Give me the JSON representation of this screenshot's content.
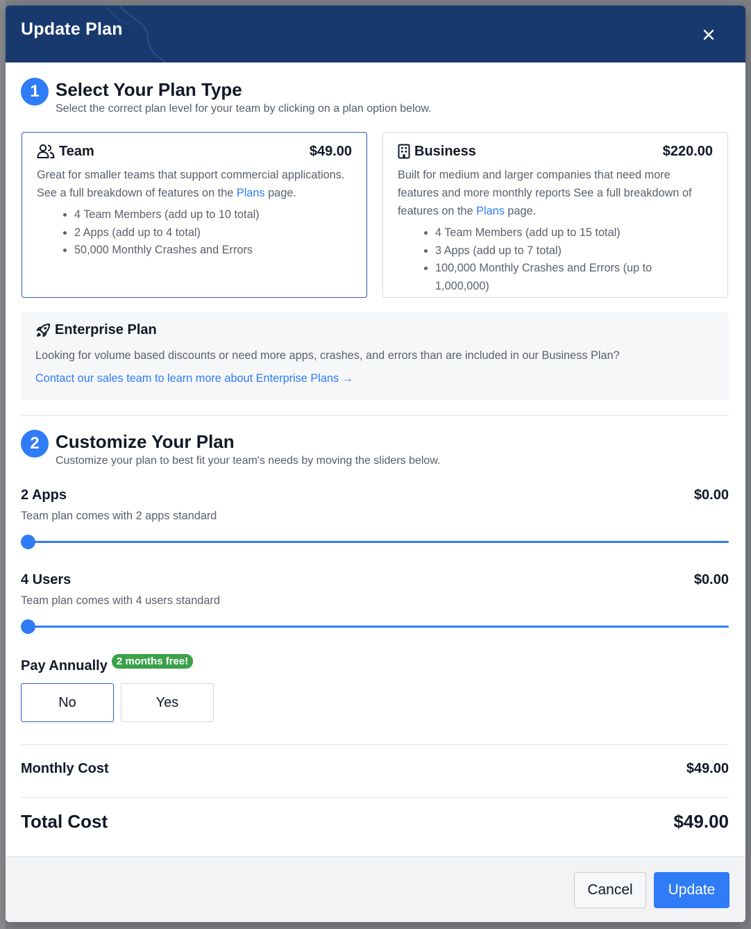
{
  "modal": {
    "title": "Update Plan"
  },
  "step1": {
    "number": "1",
    "title": "Select Your Plan Type",
    "subtitle": "Select the correct plan level for your team by clicking on a plan option below."
  },
  "plans": [
    {
      "name": "Team",
      "price": "$49.00",
      "desc_before": "Great for smaller teams that support commercial applications. See a full breakdown of features on the ",
      "desc_link": "Plans",
      "desc_after": " page.",
      "features": [
        "4 Team Members (add up to 10 total)",
        "2 Apps (add up to 4 total)",
        "50,000 Monthly Crashes and Errors"
      ],
      "selected": true,
      "icon": "users-icon"
    },
    {
      "name": "Business",
      "price": "$220.00",
      "desc_before": "Built for medium and larger companies that need more features and more monthly reports See a full breakdown of features on the ",
      "desc_link": "Plans",
      "desc_after": " page.",
      "features": [
        "4 Team Members (add up to 15 total)",
        "3 Apps (add up to 7 total)",
        "100,000 Monthly Crashes and Errors (up to 1,000,000)"
      ],
      "selected": false,
      "icon": "building-icon"
    }
  ],
  "enterprise": {
    "title": "Enterprise Plan",
    "text": "Looking for volume based discounts or need more apps, crashes, and errors than are included in our Business Plan?",
    "link": "Contact our sales team to learn more about Enterprise Plans →",
    "icon": "rocket-icon"
  },
  "step2": {
    "number": "2",
    "title": "Customize Your Plan",
    "subtitle": "Customize your plan to best fit your team's needs by moving the sliders below."
  },
  "sliders": {
    "apps": {
      "title": "2 Apps",
      "price": "$0.00",
      "subtitle": "Team plan comes with 2 apps standard",
      "value": 2,
      "min": 2,
      "max": 4
    },
    "users": {
      "title": "4 Users",
      "price": "$0.00",
      "subtitle": "Team plan comes with 4 users standard",
      "value": 4,
      "min": 4,
      "max": 10
    }
  },
  "pay_annually": {
    "label": "Pay Annually",
    "badge": "2 months free!",
    "options": [
      "No",
      "Yes"
    ],
    "selected": "No"
  },
  "costs": {
    "monthly_label": "Monthly Cost",
    "monthly_value": "$49.00",
    "total_label": "Total Cost",
    "total_value": "$49.00"
  },
  "footer": {
    "cancel": "Cancel",
    "update": "Update"
  },
  "colors": {
    "header": "#17396e",
    "accent": "#2f7cf6",
    "badge": "#3aa14a"
  }
}
